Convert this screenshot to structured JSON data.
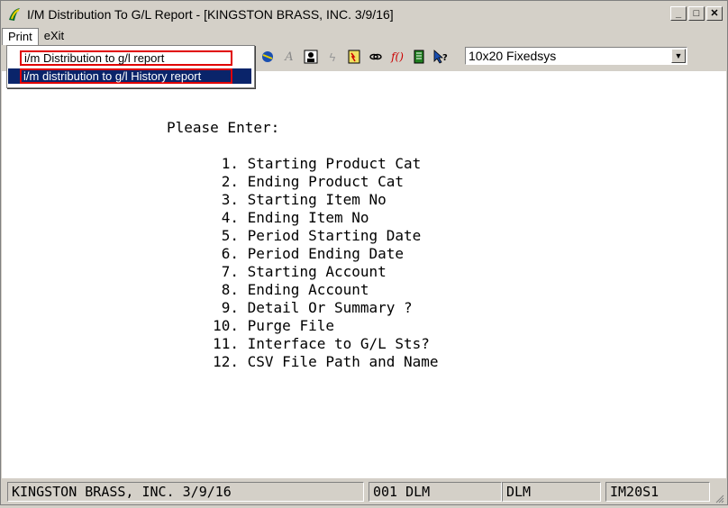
{
  "window": {
    "title": "I/M Distribution To G/L Report - [KINGSTON BRASS, INC. 3/9/16]",
    "controls": [
      "_",
      "□",
      "✕"
    ]
  },
  "menubar": {
    "items": [
      "Print",
      "eXit"
    ]
  },
  "dropdown": {
    "items": [
      "i/m Distribution to g/l report",
      "i/m distribution to g/l History report"
    ]
  },
  "toolbar": {
    "font_select": "10x20 Fixedsys"
  },
  "screen": {
    "prompt": "Please Enter:",
    "fields": [
      {
        "num": "1.",
        "label": "Starting Product Cat"
      },
      {
        "num": "2.",
        "label": "Ending Product Cat"
      },
      {
        "num": "3.",
        "label": "Starting Item No"
      },
      {
        "num": "4.",
        "label": "Ending Item No"
      },
      {
        "num": "5.",
        "label": "Period Starting Date"
      },
      {
        "num": "6.",
        "label": "Period Ending Date"
      },
      {
        "num": "7.",
        "label": "Starting Account"
      },
      {
        "num": "8.",
        "label": "Ending Account"
      },
      {
        "num": "9.",
        "label": "Detail Or Summary ?"
      },
      {
        "num": "10.",
        "label": "Purge File"
      },
      {
        "num": "11.",
        "label": "Interface to G/L Sts?"
      },
      {
        "num": "12.",
        "label": "CSV File Path and Name"
      }
    ]
  },
  "statusbar": {
    "company": "KINGSTON BRASS, INC. 3/9/16",
    "user_code": "001 DLM",
    "user": "DLM",
    "program": "IM20S1"
  },
  "colors": {
    "highlight": "#0a246a",
    "outline_red": "#e00000",
    "chrome": "#d4d0c8"
  }
}
